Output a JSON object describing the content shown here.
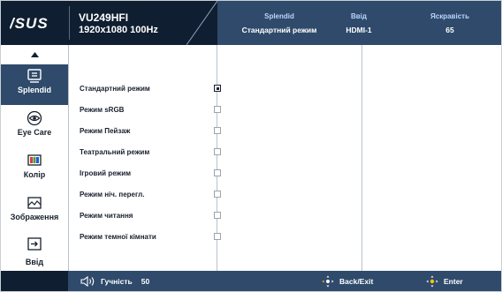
{
  "header": {
    "brand": "ASUS",
    "model": "VU249HFI",
    "resolution": "1920x1080 100Hz",
    "stats": [
      {
        "label": "Splendid",
        "value": "Стандартний режим"
      },
      {
        "label": "Ввід",
        "value": "HDMI-1"
      },
      {
        "label": "Яскравість",
        "value": "65"
      }
    ]
  },
  "sidebar": {
    "items": [
      {
        "label": "Splendid",
        "icon": "splendid-icon",
        "active": true
      },
      {
        "label": "Eye Care",
        "icon": "eye-icon",
        "active": false
      },
      {
        "label": "Колір",
        "icon": "color-bars-icon",
        "active": false
      },
      {
        "label": "Зображення",
        "icon": "image-icon",
        "active": false
      },
      {
        "label": "Ввід",
        "icon": "input-icon",
        "active": false
      }
    ]
  },
  "splendid_modes": [
    {
      "label": "Стандартний режим",
      "selected": true
    },
    {
      "label": "Режим sRGB",
      "selected": false
    },
    {
      "label": "Режим Пейзаж",
      "selected": false
    },
    {
      "label": "Театральний режим",
      "selected": false
    },
    {
      "label": "Ігровий режим",
      "selected": false
    },
    {
      "label": "Режим ніч. перегл.",
      "selected": false
    },
    {
      "label": "Режим читання",
      "selected": false
    },
    {
      "label": "Режим темної кімнати",
      "selected": false
    }
  ],
  "footer": {
    "volume_label": "Гучність",
    "volume_value": "50",
    "back_label": "Back/Exit",
    "enter_label": "Enter"
  },
  "colors": {
    "header_dark": "#101e31",
    "header_blue": "#2f4a6b",
    "accent_text": "#b8d6ff"
  }
}
